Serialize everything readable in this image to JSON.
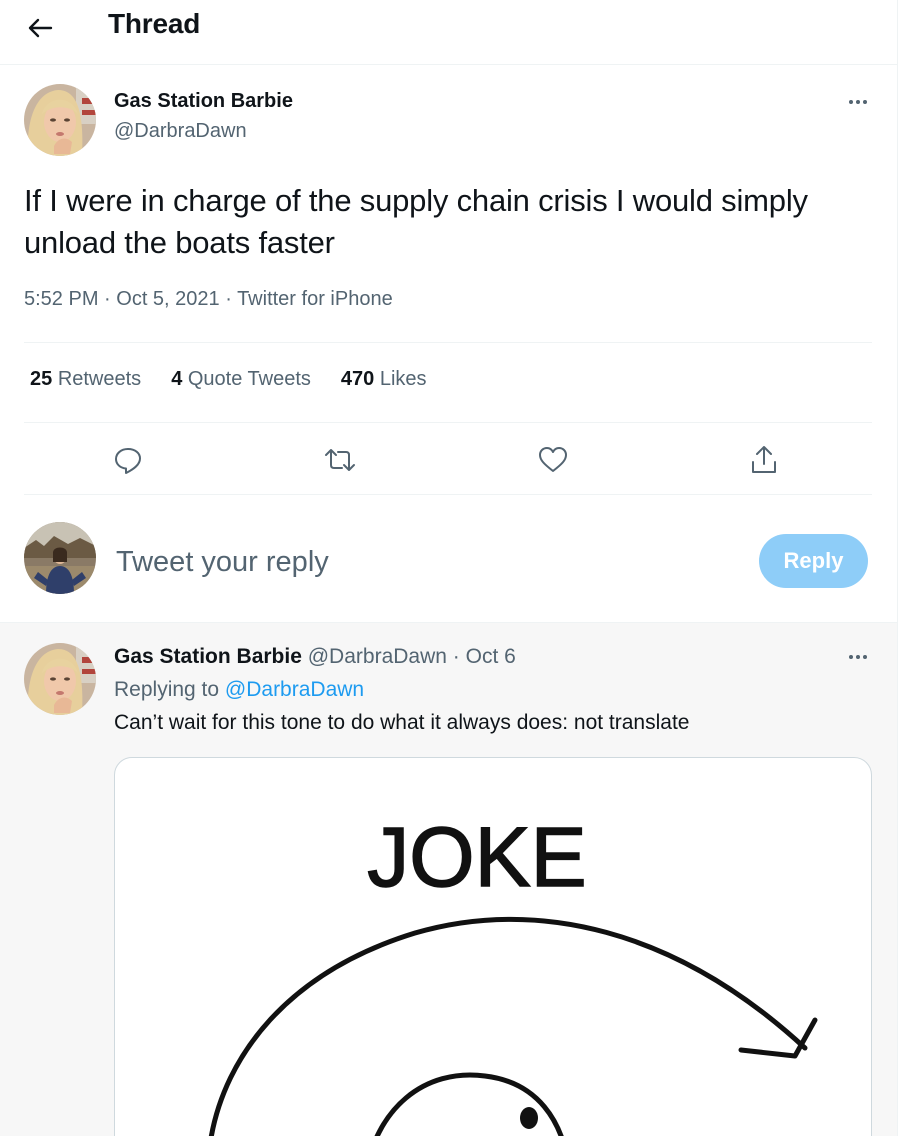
{
  "header": {
    "title": "Thread",
    "back_icon": "arrow-left-icon"
  },
  "main_tweet": {
    "author_name": "Gas Station Barbie",
    "author_handle": "@DarbraDawn",
    "text": "If I were in charge of the supply chain crisis I would simply unload the boats faster",
    "timestamp": "5:52 PM · Oct 5, 2021 · Twitter for iPhone",
    "stats": {
      "retweets_count": "25",
      "retweets_label": "Retweets",
      "quotes_count": "4",
      "quotes_label": "Quote Tweets",
      "likes_count": "470",
      "likes_label": "Likes"
    },
    "actions": [
      "reply-icon",
      "retweet-icon",
      "like-icon",
      "share-icon"
    ]
  },
  "composer": {
    "placeholder": "Tweet your reply",
    "button_label": "Reply"
  },
  "reply_tweet": {
    "author_name": "Gas Station Barbie",
    "author_handle": "@DarbraDawn",
    "separator": "·",
    "date": "Oct 6",
    "replying_prefix": "Replying to",
    "replying_handle": "@DarbraDawn",
    "text": "Can’t wait for this tone to do what it always does: not translate",
    "image_text": "JOKE"
  },
  "colors": {
    "accent": "#1d9bf0",
    "reply_button": "#8ecdf8",
    "secondary_text": "#536471"
  }
}
